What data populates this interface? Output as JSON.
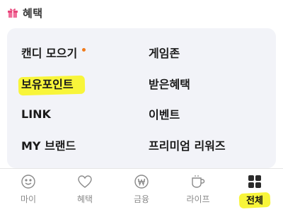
{
  "section": {
    "title": "혜택",
    "icon": "gift-icon"
  },
  "menu": {
    "left": [
      {
        "label": "캔디 모으기",
        "new_dot": true
      },
      {
        "label": "보유포인트",
        "highlighted": true
      },
      {
        "label": "LINK"
      },
      {
        "label": "MY 브랜드"
      }
    ],
    "right": [
      {
        "label": "게임존"
      },
      {
        "label": "받은혜택"
      },
      {
        "label": "이벤트"
      },
      {
        "label": "프리미엄 리워즈"
      }
    ]
  },
  "colors": {
    "highlight": "#f8f53a",
    "dot": "#f07b1c",
    "card_bg": "#f2f3f8"
  },
  "bottom_nav": [
    {
      "label": "마이",
      "icon": "smile-icon"
    },
    {
      "label": "혜택",
      "icon": "heart-icon"
    },
    {
      "label": "금융",
      "icon": "won-coin-icon"
    },
    {
      "label": "라이프",
      "icon": "cup-icon"
    },
    {
      "label": "전체",
      "icon": "grid-icon",
      "active": true
    }
  ]
}
